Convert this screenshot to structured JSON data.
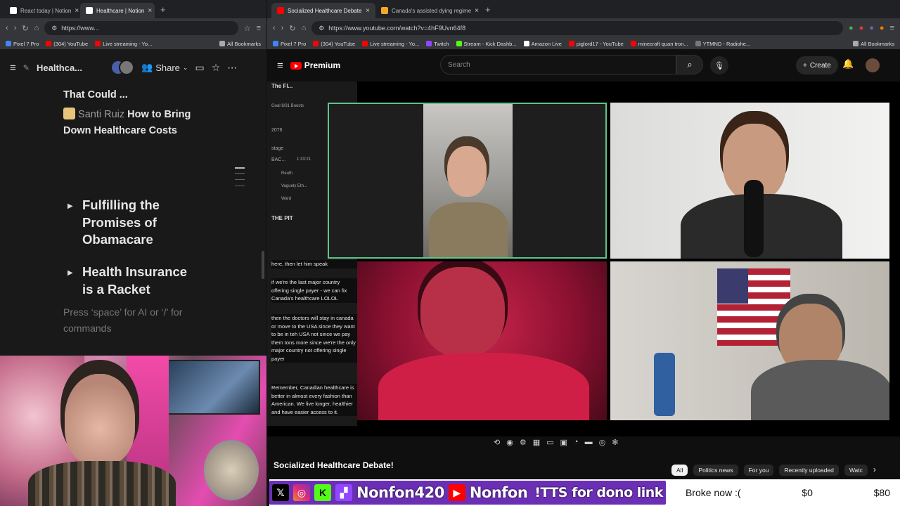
{
  "left_browser": {
    "tabs": [
      {
        "title": "React today | Notion",
        "color": "#ffffff"
      },
      {
        "title": "Healthcare | Notion",
        "color": "#ffffff"
      }
    ],
    "url": "https://www...",
    "bookmarks": [
      "Pixel 7 Pro",
      "(304) YouTube",
      "Live streaming - Yo...",
      "All Bookmarks"
    ]
  },
  "notion": {
    "title": "Healthca...",
    "share_label": "Share",
    "partial_heading": "That Could ...",
    "link_author": "Santi Ruiz",
    "link_title_line1": "How to Bring",
    "link_title_line2": "Down Healthcare Costs",
    "toggle1": [
      "Fulfilling the",
      "Promises of",
      "Obamacare"
    ],
    "toggle2": [
      "Health Insurance",
      "is a Racket"
    ],
    "placeholder": [
      "Press ‘space’ for AI or ‘/’ for",
      "commands"
    ]
  },
  "right_browser": {
    "tabs": [
      {
        "title": "Socialized Healthcare Debate",
        "color": "#ff0000"
      },
      {
        "title": "Canada's assisted dying regime",
        "color": "#f5a623"
      }
    ],
    "url": "https://www.youtube.com/watch?v=4hF9Uvn64f8",
    "bookmarks": [
      "Pixel 7 Pro",
      "(304) YouTube",
      "Live streaming - Yo...",
      "Twitch",
      "Stream - Kick Dashb...",
      "Amazon Live",
      "piglord17 - YouTube",
      "minecraft quan tron...",
      "YTMND - Radiohe...",
      "All Bookmarks"
    ]
  },
  "youtube": {
    "brand": "Premium",
    "search_placeholder": "Search",
    "create_label": "Create",
    "video_title": "Socialized Healthcare Debate!",
    "chips": [
      "All",
      "Politics news",
      "For you",
      "Recently uploaded",
      "Watc"
    ],
    "chat": {
      "server": "The Fl...",
      "goal": "Goal  8/31 Boosts",
      "num": "2076",
      "stage": "stage",
      "bac": "BAC...",
      "time": "1:33:21",
      "users": [
        "Reuth",
        "Vaguely Eth...",
        "Ward"
      ],
      "pit": "THE PIT",
      "msg1": "here, then let him speak",
      "msg2": "if we're the last major country offering single payer - we can fix Canada's healthcare LOLOL",
      "msg3": "then the doctors will stay in canada or move to the USA since they want to be in teh USA not since we pay them tons more since we're the only major country not offering single payer",
      "msg4": "Remember, Canadian healthcare is better in almost every fashion than American. We live longer, healthier and have easier access to it."
    }
  },
  "overlay": {
    "name1": "Nonfon420",
    "name2": "Nonfon",
    "tts": "!TTS for dono link",
    "goal_label": "Broke now :(",
    "goal_current": "$0",
    "goal_target": "$80"
  }
}
